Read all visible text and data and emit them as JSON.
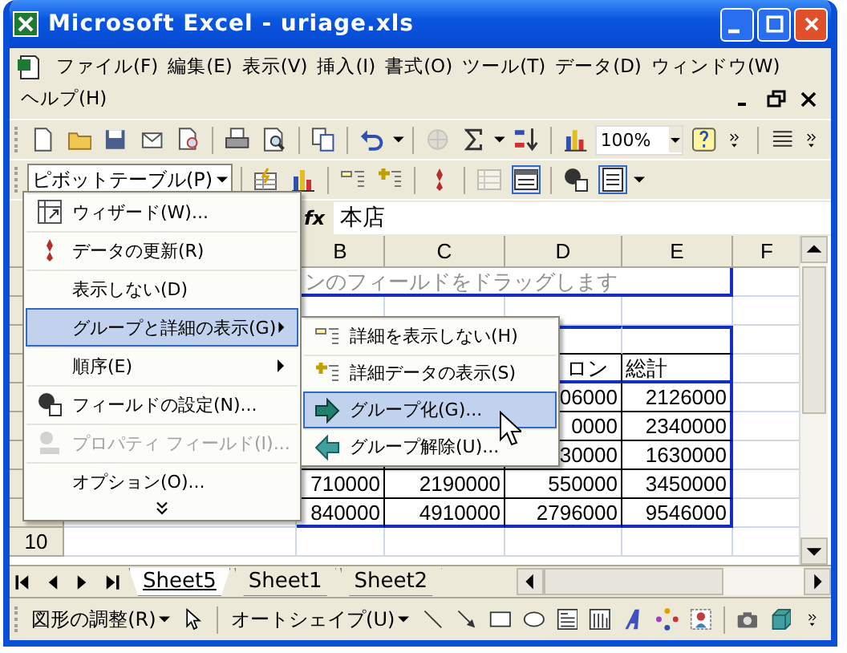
{
  "window": {
    "title": "Microsoft Excel - uriage.xls"
  },
  "menu_bar": [
    "ファイル(F)",
    "編集(E)",
    "表示(V)",
    "挿入(I)",
    "書式(O)",
    "ツール(T)",
    "データ(D)",
    "ウィンドウ(W)",
    "ヘルプ(H)"
  ],
  "standard_toolbar": {
    "zoom": "100%",
    "tools": [
      {
        "disabled": false
      },
      {
        "disabled": false
      },
      {
        "disabled": false
      },
      {
        "disabled": false
      },
      {
        "disabled": false
      },
      {
        "disabled": false
      },
      {
        "disabled": false
      },
      {
        "disabled": false
      },
      {
        "disabled": false
      },
      {
        "disabled": false
      },
      {
        "disabled": true
      },
      {
        "disabled": false
      },
      {
        "disabled": false
      },
      {
        "disabled": false
      },
      {
        "disabled": false
      },
      {
        "disabled": false
      },
      {
        "disabled": false
      },
      {
        "disabled": false
      },
      {
        "disabled": false
      }
    ]
  },
  "pivot_toolbar": {
    "button": {
      "label": "ピボットテーブル(P)",
      "pressed": true
    },
    "tools": [
      {
        "pressed": false,
        "disabled": false
      },
      {
        "pressed": false,
        "disabled": false
      },
      {
        "pressed": false,
        "disabled": false
      },
      {
        "pressed": false,
        "disabled": false
      },
      {
        "pressed": false,
        "disabled": false
      },
      {
        "pressed": false,
        "disabled": true
      },
      {
        "pressed": true,
        "disabled": false
      },
      {
        "pressed": false,
        "disabled": false
      },
      {
        "pressed": true,
        "disabled": false
      },
      {
        "pressed": false,
        "disabled": false
      }
    ]
  },
  "formula_bar": {
    "function_label": "fx",
    "value": "本店"
  },
  "sheet": {
    "column_headers": [
      "B",
      "C",
      "D",
      "E",
      "F"
    ],
    "rows": [
      {
        "hint": "ンのフィールドをドラッグします"
      },
      {},
      {},
      {
        "cells": {
          "d": "ロン",
          "e": "総計"
        }
      },
      {
        "cells": {
          "d": "06000",
          "e": "2126000"
        }
      },
      {
        "cells": {
          "d": "0000",
          "e": "2340000"
        }
      },
      {
        "cells": {
          "d": "30000",
          "e": "1630000"
        }
      },
      {
        "cells": {
          "b": "710000",
          "c": "2190000",
          "d": "550000",
          "e": "3450000"
        }
      },
      {
        "cells": {
          "b": "840000",
          "c": "4910000",
          "d": "2796000",
          "e": "9546000"
        }
      },
      {
        "number": "10"
      }
    ]
  },
  "sheet_tabs": [
    {
      "label": "Sheet5",
      "selected": true
    },
    {
      "label": "Sheet1",
      "selected": false
    },
    {
      "label": "Sheet2",
      "selected": false
    }
  ],
  "drawing_toolbar": {
    "arrange": "図形の調整(R)",
    "autoshapes": "オートシェイプ(U)"
  },
  "context_menu": {
    "items": [
      {
        "label": "ウィザード(W)...",
        "selected": false,
        "disabled": false,
        "submenu": false
      },
      {
        "label": "データの更新(R)",
        "selected": false,
        "disabled": false,
        "submenu": false
      },
      {
        "label": "表示しない(D)",
        "selected": false,
        "disabled": false,
        "submenu": false
      },
      {
        "label": "グループと詳細の表示(G)",
        "selected": true,
        "disabled": false,
        "submenu": true
      },
      {
        "label": "順序(E)",
        "selected": false,
        "disabled": false,
        "submenu": true
      },
      {
        "label": "フィールドの設定(N)...",
        "selected": false,
        "disabled": false,
        "submenu": false
      },
      {
        "label": "プロパティ フィールド(I)...",
        "selected": false,
        "disabled": true,
        "submenu": false
      },
      {
        "label": "オプション(O)...",
        "selected": false,
        "disabled": false,
        "submenu": false
      }
    ]
  },
  "submenu": {
    "items": [
      {
        "label": "詳細を表示しない(H)",
        "selected": false
      },
      {
        "label": "詳細データの表示(S)",
        "selected": false
      },
      {
        "label": "グループ化(G)...",
        "selected": true
      },
      {
        "label": "グループ解除(U)...",
        "selected": false
      }
    ]
  }
}
